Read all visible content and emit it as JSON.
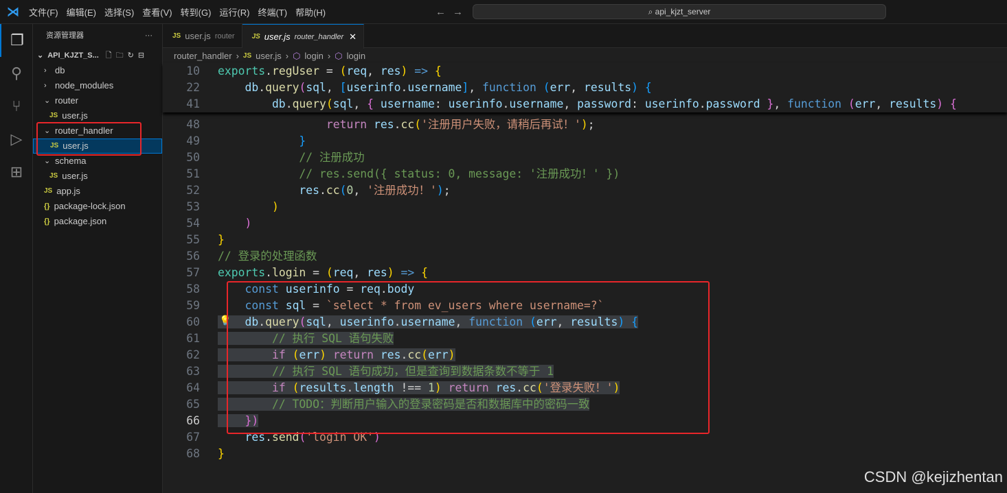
{
  "menu": [
    "文件(F)",
    "编辑(E)",
    "选择(S)",
    "查看(V)",
    "转到(G)",
    "运行(R)",
    "终端(T)",
    "帮助(H)"
  ],
  "search": "api_kjzt_server",
  "explorer": {
    "title": "资源管理器",
    "more": "···",
    "project": "API_KJZT_S...",
    "items": [
      {
        "label": "db",
        "type": "folder",
        "depth": 1
      },
      {
        "label": "node_modules",
        "type": "folder",
        "depth": 1
      },
      {
        "label": "router",
        "type": "folder-open",
        "depth": 1
      },
      {
        "label": "user.js",
        "type": "js",
        "depth": 2
      },
      {
        "label": "router_handler",
        "type": "folder-open",
        "depth": 1
      },
      {
        "label": "user.js",
        "type": "js",
        "depth": 2,
        "selected": true
      },
      {
        "label": "schema",
        "type": "folder-open",
        "depth": 1
      },
      {
        "label": "user.js",
        "type": "js",
        "depth": 2
      },
      {
        "label": "app.js",
        "type": "js",
        "depth": 1
      },
      {
        "label": "package-lock.json",
        "type": "json",
        "depth": 1
      },
      {
        "label": "package.json",
        "type": "json",
        "depth": 1
      }
    ]
  },
  "tabs": [
    {
      "label": "user.js",
      "desc": "router"
    },
    {
      "label": "user.js",
      "desc": "router_handler",
      "active": true
    }
  ],
  "breadcrumb": [
    "router_handler",
    "user.js",
    "login",
    "login"
  ],
  "sticky": [
    {
      "n": "10",
      "t": [
        [
          "exports",
          "t"
        ],
        [
          ".",
          "p"
        ],
        [
          "regUser",
          "f"
        ],
        [
          " = ",
          "p"
        ],
        [
          "(",
          "y"
        ],
        [
          "req",
          "v"
        ],
        [
          ", ",
          "p"
        ],
        [
          "res",
          "v"
        ],
        [
          ")",
          "y"
        ],
        [
          " => ",
          "b"
        ],
        [
          "{",
          "y"
        ]
      ]
    },
    {
      "n": "22",
      "t": [
        [
          "    db",
          "v"
        ],
        [
          ".",
          "p"
        ],
        [
          "query",
          "f"
        ],
        [
          "(",
          "m"
        ],
        [
          "sql",
          "v"
        ],
        [
          ", ",
          "p"
        ],
        [
          "[",
          "u"
        ],
        [
          "userinfo",
          "v"
        ],
        [
          ".",
          "p"
        ],
        [
          "username",
          "v"
        ],
        [
          "]",
          "u"
        ],
        [
          ", ",
          "p"
        ],
        [
          "function",
          "b"
        ],
        [
          " ",
          "p"
        ],
        [
          "(",
          "u"
        ],
        [
          "err",
          "v"
        ],
        [
          ", ",
          "p"
        ],
        [
          "results",
          "v"
        ],
        [
          ")",
          "u"
        ],
        [
          " ",
          "p"
        ],
        [
          "{",
          "u"
        ]
      ]
    },
    {
      "n": "41",
      "t": [
        [
          "        db",
          "v"
        ],
        [
          ".",
          "p"
        ],
        [
          "query",
          "f"
        ],
        [
          "(",
          "y"
        ],
        [
          "sql",
          "v"
        ],
        [
          ", ",
          "p"
        ],
        [
          "{",
          "m"
        ],
        [
          " username",
          "v"
        ],
        [
          ": ",
          "p"
        ],
        [
          "userinfo",
          "v"
        ],
        [
          ".",
          "p"
        ],
        [
          "username",
          "v"
        ],
        [
          ", ",
          "p"
        ],
        [
          "password",
          "v"
        ],
        [
          ": ",
          "p"
        ],
        [
          "userinfo",
          "v"
        ],
        [
          ".",
          "p"
        ],
        [
          "password",
          "v"
        ],
        [
          " ",
          "p"
        ],
        [
          "}",
          "m"
        ],
        [
          ", ",
          "p"
        ],
        [
          "function",
          "b"
        ],
        [
          " ",
          "p"
        ],
        [
          "(",
          "m"
        ],
        [
          "err",
          "v"
        ],
        [
          ", ",
          "p"
        ],
        [
          "results",
          "v"
        ],
        [
          ")",
          "m"
        ],
        [
          " ",
          "p"
        ],
        [
          "{",
          "m"
        ]
      ]
    }
  ],
  "lines": [
    {
      "n": "48",
      "t": [
        [
          "                ",
          "p"
        ],
        [
          "return",
          "k"
        ],
        [
          " res",
          "v"
        ],
        [
          ".",
          "p"
        ],
        [
          "cc",
          "f"
        ],
        [
          "(",
          "y"
        ],
        [
          "'注册用户失败，请稍后再试！'",
          "s"
        ],
        [
          ")",
          "y"
        ],
        [
          ";",
          "p"
        ]
      ]
    },
    {
      "n": "49",
      "t": [
        [
          "            ",
          "p"
        ],
        [
          "}",
          "u"
        ]
      ]
    },
    {
      "n": "50",
      "t": [
        [
          "            ",
          "p"
        ],
        [
          "// 注册成功",
          "c"
        ]
      ]
    },
    {
      "n": "51",
      "t": [
        [
          "            ",
          "p"
        ],
        [
          "// res.send({ status: 0, message: '注册成功！' })",
          "c"
        ]
      ]
    },
    {
      "n": "52",
      "t": [
        [
          "            res",
          "v"
        ],
        [
          ".",
          "p"
        ],
        [
          "cc",
          "f"
        ],
        [
          "(",
          "u"
        ],
        [
          "0",
          "n"
        ],
        [
          ", ",
          "p"
        ],
        [
          "'注册成功！'",
          "s"
        ],
        [
          ")",
          "u"
        ],
        [
          ";",
          "p"
        ]
      ]
    },
    {
      "n": "53",
      "t": [
        [
          "        ",
          "p"
        ],
        [
          ")",
          "y"
        ]
      ]
    },
    {
      "n": "54",
      "t": [
        [
          "    ",
          "p"
        ],
        [
          ")",
          "m"
        ]
      ]
    },
    {
      "n": "55",
      "t": [
        [
          "}",
          "y"
        ]
      ]
    },
    {
      "n": "56",
      "t": [
        [
          "// 登录的处理函数",
          "c"
        ]
      ]
    },
    {
      "n": "57",
      "t": [
        [
          "exports",
          "t"
        ],
        [
          ".",
          "p"
        ],
        [
          "login",
          "f"
        ],
        [
          " = ",
          "p"
        ],
        [
          "(",
          "y"
        ],
        [
          "req",
          "v"
        ],
        [
          ", ",
          "p"
        ],
        [
          "res",
          "v"
        ],
        [
          ")",
          "y"
        ],
        [
          " => ",
          "b"
        ],
        [
          "{",
          "y"
        ]
      ]
    },
    {
      "n": "58",
      "t": [
        [
          "    ",
          "p"
        ],
        [
          "const",
          "b"
        ],
        [
          " userinfo",
          "v"
        ],
        [
          " = ",
          "p"
        ],
        [
          "req",
          "v"
        ],
        [
          ".",
          "p"
        ],
        [
          "body",
          "v"
        ]
      ]
    },
    {
      "n": "59",
      "t": [
        [
          "    ",
          "p"
        ],
        [
          "const",
          "b"
        ],
        [
          " sql",
          "v"
        ],
        [
          " = ",
          "p"
        ],
        [
          "`select * from ev_users where username=?`",
          "s"
        ]
      ]
    },
    {
      "n": "60",
      "h": true,
      "t": [
        [
          "    db",
          "v"
        ],
        [
          ".",
          "p"
        ],
        [
          "query",
          "f"
        ],
        [
          "(",
          "m"
        ],
        [
          "sql",
          "v"
        ],
        [
          ", ",
          "p"
        ],
        [
          "userinfo",
          "v"
        ],
        [
          ".",
          "p"
        ],
        [
          "username",
          "v"
        ],
        [
          ", ",
          "p"
        ],
        [
          "function",
          "b"
        ],
        [
          " ",
          "p"
        ],
        [
          "(",
          "u"
        ],
        [
          "err",
          "v"
        ],
        [
          ", ",
          "p"
        ],
        [
          "results",
          "v"
        ],
        [
          ")",
          "u"
        ],
        [
          " ",
          "p"
        ],
        [
          "{",
          "u"
        ]
      ]
    },
    {
      "n": "61",
      "h": true,
      "t": [
        [
          "        ",
          "p"
        ],
        [
          "// 执行 SQL 语句失败",
          "c"
        ]
      ]
    },
    {
      "n": "62",
      "h": true,
      "t": [
        [
          "        ",
          "p"
        ],
        [
          "if",
          "k"
        ],
        [
          " ",
          "p"
        ],
        [
          "(",
          "y"
        ],
        [
          "err",
          "v"
        ],
        [
          ")",
          "y"
        ],
        [
          " ",
          "p"
        ],
        [
          "return",
          "k"
        ],
        [
          " res",
          "v"
        ],
        [
          ".",
          "p"
        ],
        [
          "cc",
          "f"
        ],
        [
          "(",
          "y"
        ],
        [
          "err",
          "v"
        ],
        [
          ")",
          "y"
        ]
      ]
    },
    {
      "n": "63",
      "h": true,
      "t": [
        [
          "        ",
          "p"
        ],
        [
          "// 执行 SQL 语句成功，但是查询到数据条数不等于 1",
          "c"
        ]
      ]
    },
    {
      "n": "64",
      "h": true,
      "t": [
        [
          "        ",
          "p"
        ],
        [
          "if",
          "k"
        ],
        [
          " ",
          "p"
        ],
        [
          "(",
          "y"
        ],
        [
          "results",
          "v"
        ],
        [
          ".",
          "p"
        ],
        [
          "length",
          "v"
        ],
        [
          " !== ",
          "p"
        ],
        [
          "1",
          "n"
        ],
        [
          ")",
          "y"
        ],
        [
          " ",
          "p"
        ],
        [
          "return",
          "k"
        ],
        [
          " res",
          "v"
        ],
        [
          ".",
          "p"
        ],
        [
          "cc",
          "f"
        ],
        [
          "(",
          "y"
        ],
        [
          "'登录失败！'",
          "s"
        ],
        [
          ")",
          "y"
        ]
      ]
    },
    {
      "n": "65",
      "h": true,
      "t": [
        [
          "        ",
          "p"
        ],
        [
          "// TODO：判断用户输入的登录密码是否和数据库中的密码一致",
          "c"
        ]
      ]
    },
    {
      "n": "66",
      "h": true,
      "cur": true,
      "t": [
        [
          "    ",
          "p"
        ],
        [
          "})",
          "m"
        ]
      ]
    },
    {
      "n": "67",
      "t": [
        [
          "    res",
          "v"
        ],
        [
          ".",
          "p"
        ],
        [
          "send",
          "f"
        ],
        [
          "(",
          "m"
        ],
        [
          "'login OK'",
          "s"
        ],
        [
          ")",
          "m"
        ]
      ]
    },
    {
      "n": "68",
      "t": [
        [
          "}",
          "y"
        ]
      ]
    }
  ],
  "watermark": "CSDN @kejizhentan",
  "colors": {
    "accent": "#0078d4",
    "annotation": "#e8262a"
  }
}
